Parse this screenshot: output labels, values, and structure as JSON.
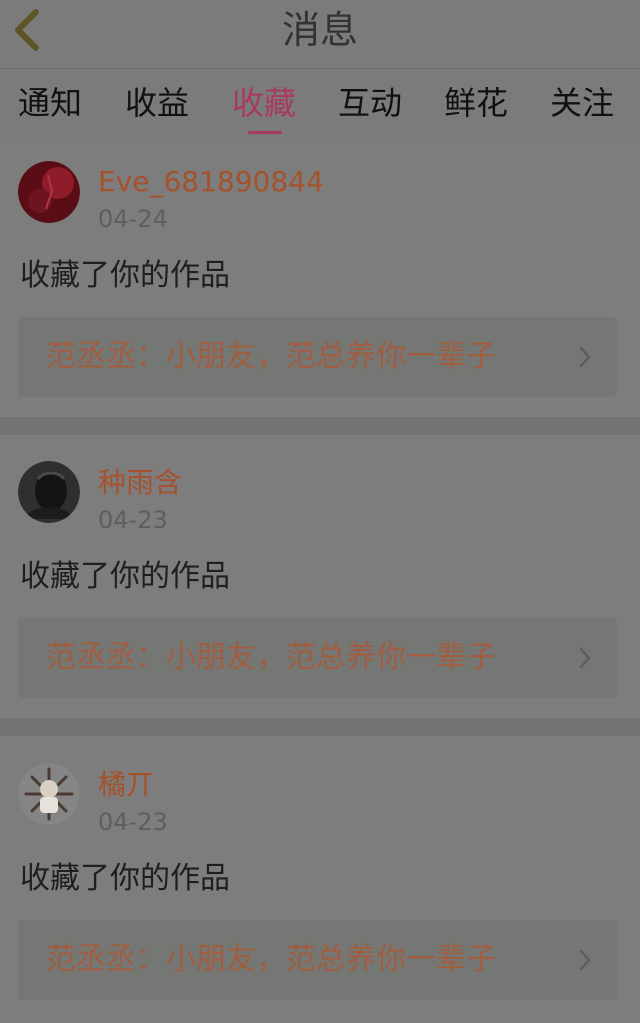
{
  "header": {
    "title": "消息"
  },
  "tabs": [
    {
      "label": "通知"
    },
    {
      "label": "收益"
    },
    {
      "label": "收藏"
    },
    {
      "label": "互动"
    },
    {
      "label": "鲜花"
    },
    {
      "label": "关注"
    }
  ],
  "active_tab": "收藏",
  "messages": [
    {
      "username": "Eve_681890844",
      "date": "04-24",
      "action": "收藏了你的作品",
      "work_title": "范丞丞：小朋友，范总养你一辈子"
    },
    {
      "username": "种雨含",
      "date": "04-23",
      "action": "收藏了你的作品",
      "work_title": "范丞丞：小朋友，范总养你一辈子"
    },
    {
      "username": "橘丌",
      "date": "04-23",
      "action": "收藏了你的作品",
      "work_title": "范丞丞：小朋友，范总养你一辈子"
    }
  ],
  "colors": {
    "accent": "#a83a62",
    "username": "#a5522c",
    "work_title": "#a15d40"
  },
  "icons": {
    "back": "chevron-left-icon",
    "work_arrow": "chevron-right-icon"
  }
}
